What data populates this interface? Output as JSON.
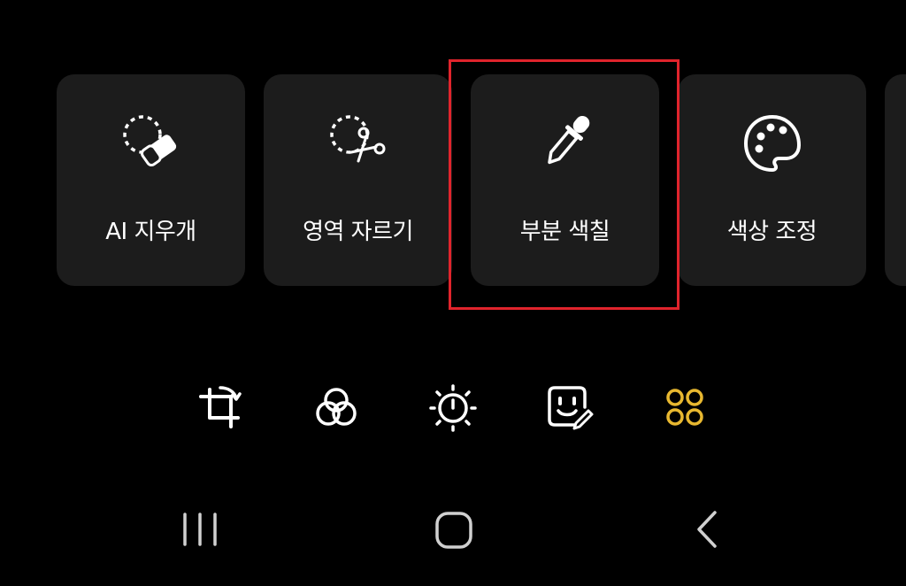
{
  "tools": [
    {
      "label": "AI 지우개",
      "icon": "ai-eraser-icon"
    },
    {
      "label": "영역 자르기",
      "icon": "area-cut-scissors-icon"
    },
    {
      "label": "부분 색칠",
      "icon": "eyedropper-icon",
      "highlighted": true
    },
    {
      "label": "색상 조정",
      "icon": "palette-icon"
    },
    {
      "label": "",
      "icon": "partial-card"
    }
  ],
  "bottom_toolbar": [
    {
      "icon": "crop-rotate-icon"
    },
    {
      "icon": "filters-icon"
    },
    {
      "icon": "brightness-icon"
    },
    {
      "icon": "sticker-decorate-icon"
    },
    {
      "icon": "more-tools-icon",
      "active": true
    }
  ],
  "navbar": [
    {
      "icon": "recent-apps-icon"
    },
    {
      "icon": "home-icon"
    },
    {
      "icon": "back-icon"
    }
  ],
  "colors": {
    "background": "#000000",
    "card": "#1c1c1c",
    "highlight": "#e0242c",
    "active_accent": "#e8b830",
    "icon": "#ffffff"
  }
}
